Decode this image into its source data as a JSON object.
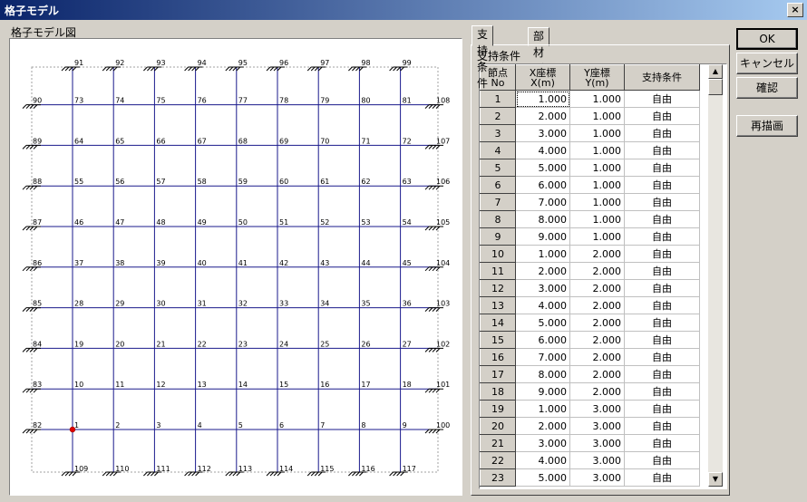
{
  "window": {
    "title": "格子モデル",
    "close": "×"
  },
  "model_view": {
    "label": "格子モデル図"
  },
  "tabs": [
    {
      "label": "支持条件"
    },
    {
      "label": "部材剛性"
    }
  ],
  "panel": {
    "label": "支持条件",
    "columns": {
      "no": "節点\nNo",
      "x": "X座標\nX(m)",
      "y": "Y座標\nY(m)",
      "cond": "支持条件"
    },
    "rows": [
      {
        "no": "1",
        "x": "1.000",
        "y": "1.000",
        "cond": "自由"
      },
      {
        "no": "2",
        "x": "2.000",
        "y": "1.000",
        "cond": "自由"
      },
      {
        "no": "3",
        "x": "3.000",
        "y": "1.000",
        "cond": "自由"
      },
      {
        "no": "4",
        "x": "4.000",
        "y": "1.000",
        "cond": "自由"
      },
      {
        "no": "5",
        "x": "5.000",
        "y": "1.000",
        "cond": "自由"
      },
      {
        "no": "6",
        "x": "6.000",
        "y": "1.000",
        "cond": "自由"
      },
      {
        "no": "7",
        "x": "7.000",
        "y": "1.000",
        "cond": "自由"
      },
      {
        "no": "8",
        "x": "8.000",
        "y": "1.000",
        "cond": "自由"
      },
      {
        "no": "9",
        "x": "9.000",
        "y": "1.000",
        "cond": "自由"
      },
      {
        "no": "10",
        "x": "1.000",
        "y": "2.000",
        "cond": "自由"
      },
      {
        "no": "11",
        "x": "2.000",
        "y": "2.000",
        "cond": "自由"
      },
      {
        "no": "12",
        "x": "3.000",
        "y": "2.000",
        "cond": "自由"
      },
      {
        "no": "13",
        "x": "4.000",
        "y": "2.000",
        "cond": "自由"
      },
      {
        "no": "14",
        "x": "5.000",
        "y": "2.000",
        "cond": "自由"
      },
      {
        "no": "15",
        "x": "6.000",
        "y": "2.000",
        "cond": "自由"
      },
      {
        "no": "16",
        "x": "7.000",
        "y": "2.000",
        "cond": "自由"
      },
      {
        "no": "17",
        "x": "8.000",
        "y": "2.000",
        "cond": "自由"
      },
      {
        "no": "18",
        "x": "9.000",
        "y": "2.000",
        "cond": "自由"
      },
      {
        "no": "19",
        "x": "1.000",
        "y": "3.000",
        "cond": "自由"
      },
      {
        "no": "20",
        "x": "2.000",
        "y": "3.000",
        "cond": "自由"
      },
      {
        "no": "21",
        "x": "3.000",
        "y": "3.000",
        "cond": "自由"
      },
      {
        "no": "22",
        "x": "4.000",
        "y": "3.000",
        "cond": "自由"
      },
      {
        "no": "23",
        "x": "5.000",
        "y": "3.000",
        "cond": "自由"
      }
    ]
  },
  "buttons": {
    "ok": "OK",
    "cancel": "キャンセル",
    "confirm": "確認",
    "redraw": "再描画"
  },
  "grid": {
    "interior_nodes": [
      [
        "1",
        "2",
        "3",
        "4",
        "5",
        "6",
        "7",
        "8",
        "9"
      ],
      [
        "10",
        "11",
        "12",
        "13",
        "14",
        "15",
        "16",
        "17",
        "18"
      ],
      [
        "19",
        "20",
        "21",
        "22",
        "23",
        "24",
        "25",
        "26",
        "27"
      ],
      [
        "28",
        "29",
        "30",
        "31",
        "32",
        "33",
        "34",
        "35",
        "36"
      ],
      [
        "37",
        "38",
        "39",
        "40",
        "41",
        "42",
        "43",
        "44",
        "45"
      ],
      [
        "46",
        "47",
        "48",
        "49",
        "50",
        "51",
        "52",
        "53",
        "54"
      ],
      [
        "55",
        "56",
        "57",
        "58",
        "59",
        "60",
        "61",
        "62",
        "63"
      ],
      [
        "64",
        "65",
        "66",
        "67",
        "68",
        "69",
        "70",
        "71",
        "72"
      ],
      [
        "73",
        "74",
        "75",
        "76",
        "77",
        "78",
        "79",
        "80",
        "81"
      ]
    ],
    "left_supports": [
      "82",
      "83",
      "84",
      "85",
      "86",
      "87",
      "88",
      "89",
      "90"
    ],
    "top_supports": [
      "91",
      "92",
      "93",
      "94",
      "95",
      "96",
      "97",
      "98",
      "99"
    ],
    "right_supports": [
      "100",
      "101",
      "102",
      "103",
      "104",
      "105",
      "106",
      "107",
      "108"
    ],
    "bottom_supports": [
      "109",
      "110",
      "111",
      "112",
      "113",
      "114",
      "115",
      "116",
      "117"
    ],
    "selected_node": "1",
    "colors": {
      "member": "#1a1a8c",
      "support": "#000000",
      "selected": "#e00000",
      "boundary": "#a0a0a0"
    }
  }
}
